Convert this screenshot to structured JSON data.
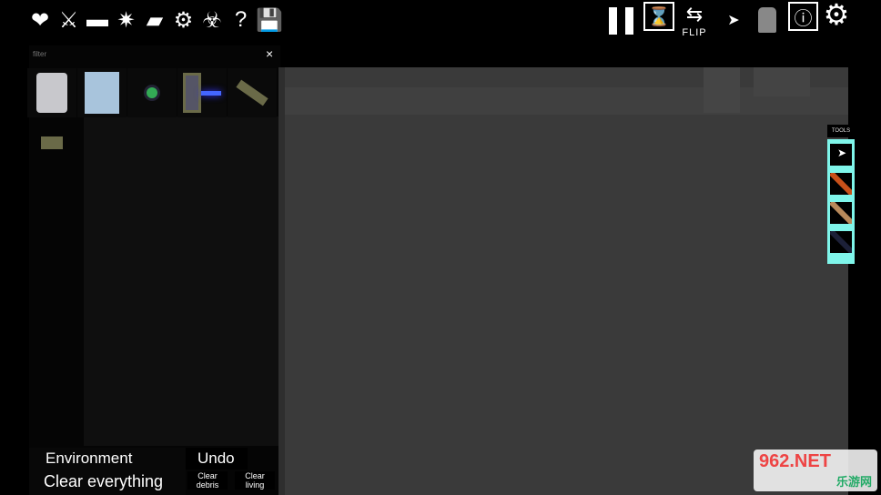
{
  "toolbar_left": [
    {
      "icon": "heart-icon",
      "glyph": "❤"
    },
    {
      "icon": "crossed-swords-icon",
      "glyph": "⚔"
    },
    {
      "icon": "gun-icon",
      "glyph": "▬"
    },
    {
      "icon": "explosion-icon",
      "glyph": "✷"
    },
    {
      "icon": "vehicle-icon",
      "glyph": "▰"
    },
    {
      "icon": "gear-icon",
      "glyph": "⚙"
    },
    {
      "icon": "biohazard-icon",
      "glyph": "☣"
    },
    {
      "icon": "help-icon",
      "glyph": "?"
    },
    {
      "icon": "save-icon",
      "glyph": "💾"
    }
  ],
  "toolbar_right": {
    "pause_icon": "pause-icon",
    "slow_motion_icon": "hourglass-icon",
    "flip_label": "FLIP",
    "cursor_icon": "cursor-icon",
    "spawn_preview_icon": "head-icon",
    "notifications_icon": "alert-icon",
    "settings_icon": "gear-icon"
  },
  "spawn_panel": {
    "filter_placeholder": "filter",
    "close_glyph": "×",
    "items": [
      "android-head",
      "blue-android-head",
      "spider-bot",
      "blue-light-turret",
      "mounted-gun",
      "tripod-turret"
    ]
  },
  "bottom": {
    "environment": "Environment",
    "undo": "Undo",
    "clear_everything": "Clear everything",
    "clear_debris": "Clear debris",
    "clear_living": "Clear living"
  },
  "tools": {
    "label": "TOOLS",
    "items": [
      {
        "name": "drag-tool",
        "color": "#ffffff"
      },
      {
        "name": "orange-wire-tool",
        "color": "#c8501a"
      },
      {
        "name": "rope-tool",
        "color": "#b8895a"
      },
      {
        "name": "dark-cable-tool",
        "color": "#1c2038"
      }
    ],
    "accent": "#7ff5ea"
  },
  "watermark": {
    "text": "962.NET",
    "subtext": "乐游网"
  }
}
